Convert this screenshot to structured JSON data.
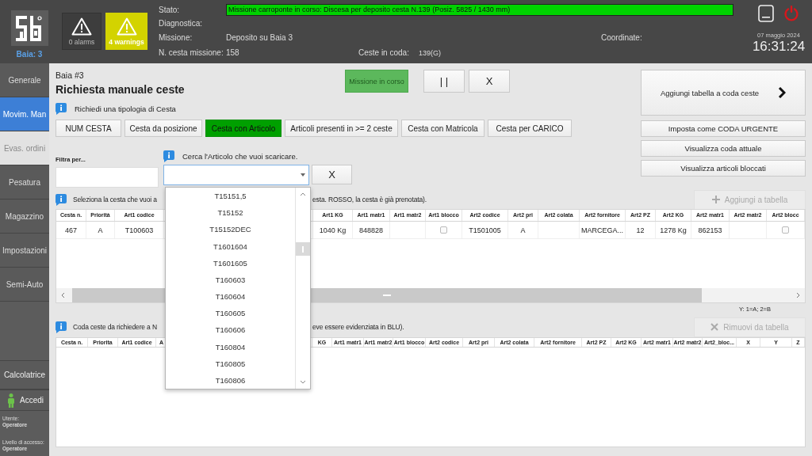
{
  "header": {
    "location": "Baia: 3",
    "indicators": [
      {
        "label": "0 alarms",
        "active": false
      },
      {
        "label": "4 warnings",
        "active": true
      }
    ],
    "status_label": "Stato:",
    "status_value": "Missione carroponte in corso: Discesa per deposito cesta N.139 (Posiz. 5825 / 1430 mm)",
    "diagnostics_label": "Diagnostica:",
    "mission_label": "Missione:",
    "mission_value": "Deposito su Baia 3",
    "basket_label": "N. cesta missione:",
    "basket_value": "158",
    "queue_label": "Ceste in coda:",
    "queue_value": "139(G)",
    "coordinates_label": "Coordinate:",
    "date": "07 maggio 2024",
    "time": "16:31:24"
  },
  "sidebar": {
    "items": [
      {
        "label": "Generale",
        "selected": false,
        "disabled": false
      },
      {
        "label": "Movim. Man",
        "selected": true,
        "disabled": false
      },
      {
        "label": "Evas. ordini",
        "selected": false,
        "disabled": true
      },
      {
        "label": "Pesatura",
        "selected": false,
        "disabled": false
      },
      {
        "label": "Magazzino",
        "selected": false,
        "disabled": false
      },
      {
        "label": "Impostazioni",
        "selected": false,
        "disabled": false
      },
      {
        "label": "Semi-Auto",
        "selected": false,
        "disabled": false
      }
    ],
    "calculator": "Calcolatrice",
    "login": "Accedi",
    "user_label": "Utente:",
    "user_value": "Operatore",
    "level_label": "Livello di accesso:",
    "level_value": "Operatore"
  },
  "page": {
    "subtitle": "Baia #3",
    "title": "Richiesta manuale ceste",
    "mission_buttons": [
      {
        "label": "Missione in corso",
        "kind": "status",
        "disabled": true
      },
      {
        "label": "| |",
        "kind": "plain",
        "disabled": false
      },
      {
        "label": "X",
        "kind": "plain",
        "disabled": false
      }
    ],
    "type_hint": "Richiedi una tipologia di Cesta",
    "type_tabs": [
      {
        "label": "NUM CESTA",
        "selected": false
      },
      {
        "label": "Cesta da posizione",
        "selected": false
      },
      {
        "label": "Cesta con Articolo",
        "selected": true
      },
      {
        "label": "Articoli presenti in >= 2 ceste",
        "selected": false
      },
      {
        "label": "Cesta con Matricola",
        "selected": false
      },
      {
        "label": "Cesta per CARICO",
        "selected": false
      }
    ],
    "filter_label": "Filtra per...",
    "search": {
      "hint": "Cerca l'Articolo che vuoi scaricare.",
      "clear_button": "X",
      "dropdown": {
        "expanded": true,
        "options": [
          "T15151,5",
          "T15152",
          "T15152DEC",
          "T1601604",
          "T1601605",
          "T160603",
          "T160604",
          "T160605",
          "T160606",
          "T160804",
          "T160805",
          "T160806"
        ]
      }
    },
    "side_actions": [
      {
        "label": "Aggiungi tabella a coda ceste",
        "kind": "primary"
      },
      {
        "label": "Imposta come CODA URGENTE",
        "kind": "plain"
      },
      {
        "label": "Visualizza coda attuale",
        "kind": "plain"
      },
      {
        "label": "Visualizza articoli bloccati",
        "kind": "plain"
      }
    ],
    "results": {
      "hint_start": "Seleziona la cesta che vuoi a",
      "hint_end": "esta. ROSSO, la cesta è già prenotata).",
      "action": {
        "label": "Aggiungi a tabella",
        "disabled": true
      },
      "columns": [
        "Cesta n.",
        "Priorità",
        "Art1 codice",
        null,
        "Art1 KG",
        "Art1 matr1",
        "Art1 matr2",
        "Art1 blocco",
        "Art2 codice",
        "Art2 pri",
        "Art2 colata",
        "Art2 fornitore",
        "Art2 PZ",
        "Art2 KG",
        "Art2 matr1",
        "Art2 matr2",
        "Art2 blocc"
      ],
      "rows": [
        {
          "cells": [
            "467",
            "A",
            "T100603",
            null,
            "1040 Kg",
            "848828",
            null,
            {
              "kind": "checkbox",
              "checked": false
            },
            "T1501005",
            "A",
            null,
            "MARCEGA...",
            "12",
            "1278 Kg",
            "862153",
            null,
            {
              "kind": "checkbox",
              "checked": false
            }
          ]
        }
      ],
      "legend": "Y: 1=A; 2=B"
    },
    "queue": {
      "hint_start": "Coda ceste da richiedere a N",
      "hint_end": "eve essere evidenziata in BLU).",
      "action": {
        "label": "Rimuovi da tabella",
        "disabled": true
      },
      "columns": [
        "Cesta n.",
        "Priorita",
        "Art1 codice",
        "A",
        "KG",
        "Art1 matr1",
        "Art1 matr2",
        "Art1 blocco",
        "Art2 codice",
        "Art2 pri",
        "Art2 colata",
        "Art2 fornitore",
        "Art2 PZ",
        "Art2 KG",
        "Art2 matr1",
        "Art2 matr2",
        "Art2_bloc...",
        "X",
        "Y",
        "Z"
      ]
    }
  }
}
